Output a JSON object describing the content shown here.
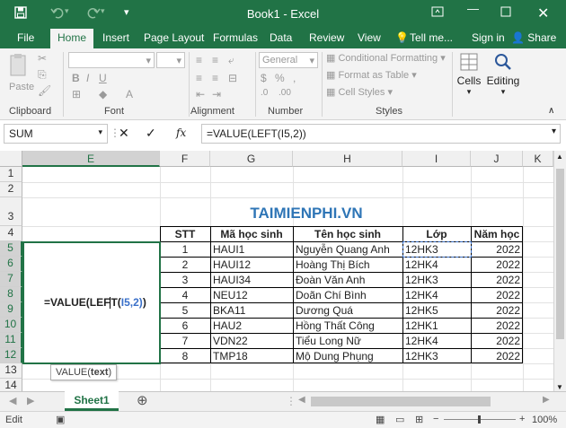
{
  "titlebar": {
    "title": "Book1 - Excel",
    "save_icon": "save-icon",
    "undo_icon": "undo-icon",
    "redo_icon": "redo-icon"
  },
  "tabs": [
    {
      "label": "File"
    },
    {
      "label": "Home"
    },
    {
      "label": "Insert"
    },
    {
      "label": "Page Layout"
    },
    {
      "label": "Formulas"
    },
    {
      "label": "Data"
    },
    {
      "label": "Review"
    },
    {
      "label": "View"
    },
    {
      "label": "Tell me..."
    }
  ],
  "account": {
    "signin": "Sign in",
    "share": "Share"
  },
  "ribbon": {
    "clipboard": {
      "paste": "Paste",
      "label": "Clipboard"
    },
    "font": {
      "label": "Font"
    },
    "alignment": {
      "label": "Alignment"
    },
    "number": {
      "format": "General",
      "label": "Number"
    },
    "styles": {
      "conditional": "Conditional Formatting",
      "table": "Format as Table",
      "cell": "Cell Styles",
      "label": "Styles"
    },
    "cells": {
      "label": "Cells"
    },
    "editing": {
      "label": "Editing"
    }
  },
  "formula_bar": {
    "name_box": "SUM",
    "fx": "fx",
    "formula": "=VALUE(LEFT(I5,2))"
  },
  "columns": [
    "E",
    "F",
    "G",
    "H",
    "I",
    "J",
    "K"
  ],
  "rows": [
    "1",
    "2",
    "3",
    "4",
    "5",
    "6",
    "7",
    "8",
    "9",
    "10",
    "11",
    "12",
    "13",
    "14"
  ],
  "sheet": {
    "title_cell": "TAIMIENPHI.VN",
    "headers": [
      "STT",
      "Mã học sinh",
      "Tên học sinh",
      "Lớp",
      "Năm học"
    ],
    "data": [
      [
        "1",
        "HAUI1",
        "Nguyễn Quang Anh",
        "12HK3",
        "2022"
      ],
      [
        "2",
        "HAUI12",
        "Hoàng Thị Bích",
        "12HK4",
        "2022"
      ],
      [
        "3",
        "HAUI34",
        "Đoàn Văn Anh",
        "12HK3",
        "2022"
      ],
      [
        "4",
        "NEU12",
        "Doãn Chí Bình",
        "12HK4",
        "2022"
      ],
      [
        "5",
        "BKA11",
        "Dương Quá",
        "12HK5",
        "2022"
      ],
      [
        "6",
        "HAU2",
        "Hồng Thất Công",
        "12HK1",
        "2022"
      ],
      [
        "7",
        "VDN22",
        "Tiểu Long Nữ",
        "12HK4",
        "2022"
      ],
      [
        "8",
        "TMP18",
        "Mộ Dung Phụng",
        "12HK3",
        "2022"
      ]
    ],
    "editing_formula": {
      "part1": "=VALUE(LEF",
      "part2": "T(",
      "ref": "I5",
      "part3": ",2)",
      "close": ")"
    },
    "tooltip": {
      "func": "VALUE(",
      "arg": "text",
      "close": ")"
    }
  },
  "sheet_tabs": [
    {
      "label": "Sheet1"
    }
  ],
  "status": {
    "mode": "Edit",
    "zoom": "100%"
  }
}
